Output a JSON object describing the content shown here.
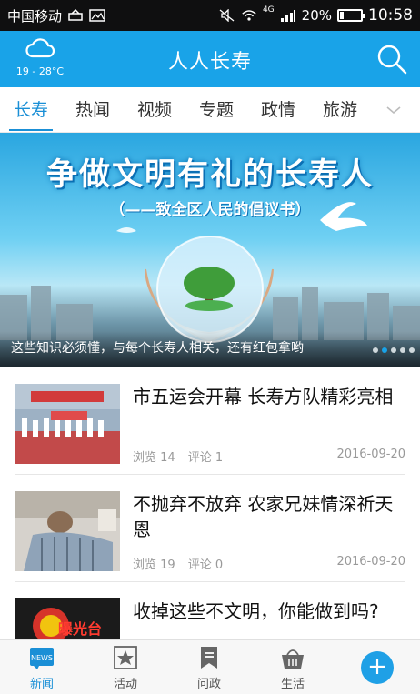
{
  "status_bar": {
    "carrier": "中国移动",
    "signal_label": "4G",
    "battery_percent": "20%",
    "battery_level": 0.2,
    "time": "10:58"
  },
  "header": {
    "title": "人人长寿",
    "weather_temp": "19 - 28°C",
    "weather_icon": "cloud-icon",
    "search_icon": "search-icon"
  },
  "tabs": [
    {
      "label": "长寿",
      "active": true
    },
    {
      "label": "热闻",
      "active": false
    },
    {
      "label": "视频",
      "active": false
    },
    {
      "label": "专题",
      "active": false
    },
    {
      "label": "政情",
      "active": false
    },
    {
      "label": "旅游",
      "active": false
    }
  ],
  "banner": {
    "headline": "争做文明有礼的长寿人",
    "subheadline": "（——致全区人民的倡议书）",
    "caption": "这些知识必须懂，与每个长寿人相关，还有红包拿哟",
    "dot_count": 5,
    "active_dot": 1
  },
  "news": [
    {
      "title": "市五运会开幕  长寿方队精彩亮相",
      "views": "浏览 14",
      "comments": "评论 1",
      "date": "2016-09-20",
      "thumb_text": ""
    },
    {
      "title": "不抛弃不放弃  农家兄妹情深祈天恩",
      "views": "浏览 19",
      "comments": "评论 0",
      "date": "2016-09-20",
      "thumb_text": ""
    },
    {
      "title": "收掉这些不文明，你能做到吗?",
      "views": "",
      "comments": "",
      "date": "",
      "thumb_text": "曝光台"
    }
  ],
  "bottom_nav": [
    {
      "label": "新闻",
      "icon": "news-icon",
      "active": true
    },
    {
      "label": "活动",
      "icon": "star-icon",
      "active": false
    },
    {
      "label": "问政",
      "icon": "bookmark-icon",
      "active": false
    },
    {
      "label": "生活",
      "icon": "basket-icon",
      "active": false
    }
  ],
  "fab_label": "+",
  "colors": {
    "brand": "#19a3e8",
    "active_text": "#1a8fd6",
    "status_bar": "#0f0f10"
  }
}
